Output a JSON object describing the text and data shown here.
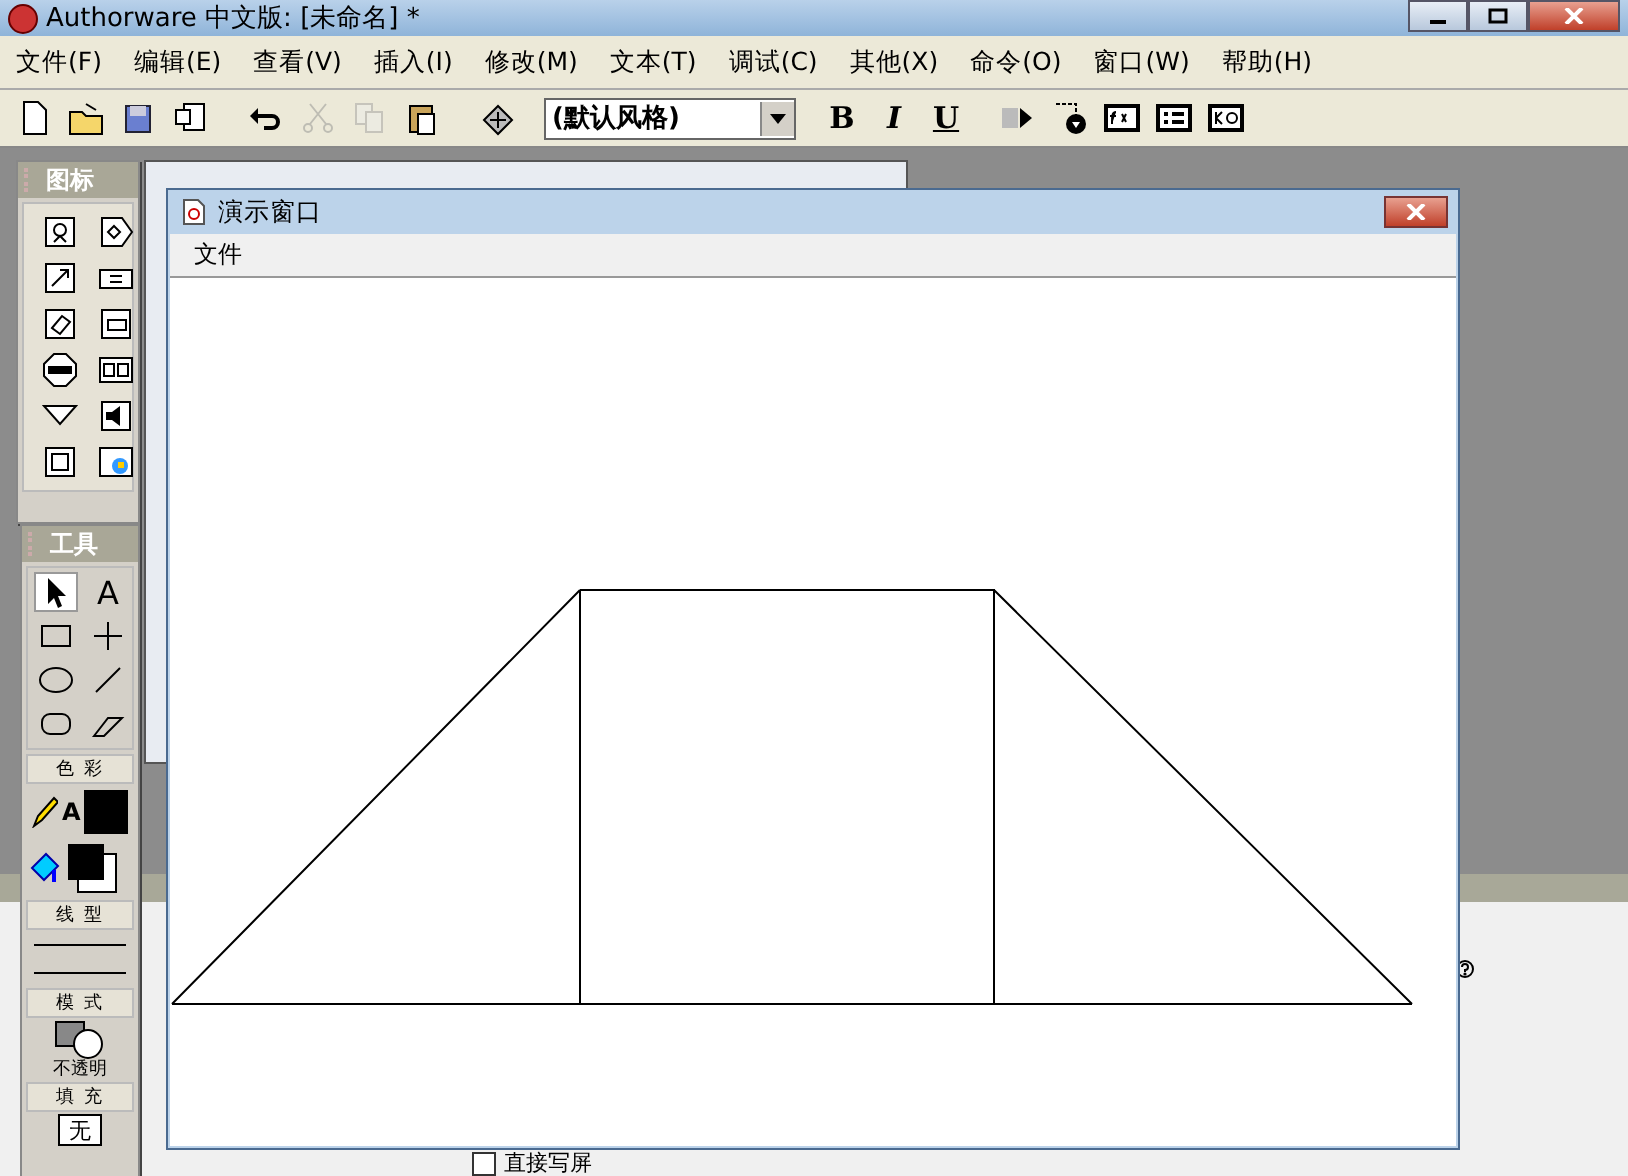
{
  "app_window": {
    "title": "Authorware 中文版: [未命名] *"
  },
  "menu_bar": [
    "文件(F)",
    "编辑(E)",
    "查看(V)",
    "插入(I)",
    "修改(M)",
    "文本(T)",
    "调试(C)",
    "其他(X)",
    "命令(O)",
    "窗口(W)",
    "帮助(H)"
  ],
  "toolbar": {
    "buttons": [
      {
        "kind": "new",
        "disabled": false
      },
      {
        "kind": "open",
        "disabled": false
      },
      {
        "kind": "save",
        "disabled": false
      },
      {
        "kind": "import",
        "disabled": false
      },
      {
        "kind": "undo",
        "disabled": false
      },
      {
        "kind": "cut",
        "disabled": true
      },
      {
        "kind": "copy",
        "disabled": true
      },
      {
        "kind": "paste",
        "disabled": false
      },
      {
        "kind": "library",
        "disabled": false
      }
    ],
    "style_dropdown": "(默认风格)",
    "format_buttons": [
      "B",
      "I",
      "U"
    ],
    "tool_buttons": [
      {
        "kind": "play"
      },
      {
        "kind": "control"
      },
      {
        "kind": "functions"
      },
      {
        "kind": "variables"
      },
      {
        "kind": "knowledge"
      }
    ]
  },
  "icons_palette": {
    "title": "图标"
  },
  "tools_palette": {
    "title": "工具",
    "tools": [
      {
        "kind": "pointer",
        "selected": true
      },
      {
        "kind": "text",
        "label": "A",
        "selected": false
      },
      {
        "kind": "rect",
        "selected": false
      },
      {
        "kind": "cross",
        "selected": false
      },
      {
        "kind": "ellipse",
        "selected": false
      },
      {
        "kind": "line",
        "selected": false
      },
      {
        "kind": "rounded",
        "selected": false
      },
      {
        "kind": "polygon",
        "selected": false
      }
    ],
    "color_section": "色 彩",
    "text_color_label": "A",
    "line_section": "线 型",
    "mode_section": "模 式",
    "mode_value": "不透明",
    "fill_section": "填 充",
    "fill_value": "无"
  },
  "presentation_window": {
    "title": "演示窗口",
    "menu": [
      "文件"
    ]
  },
  "properties_panel": {
    "checkbox": {
      "label": "直接写屏",
      "checked": false
    }
  }
}
